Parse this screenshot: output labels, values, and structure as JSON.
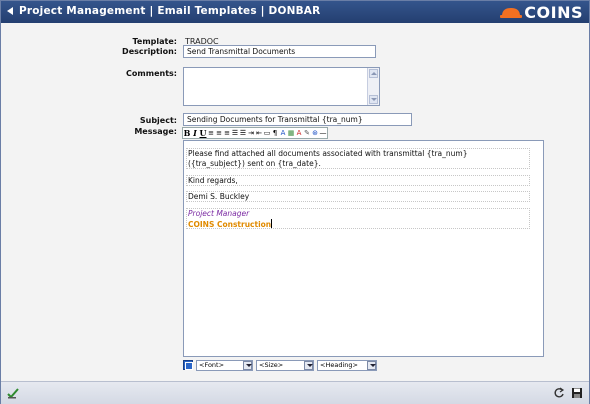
{
  "header": {
    "title": "Project Management | Email Templates | DONBAR",
    "logo_text": "COINS",
    "logo_color": "#f37021"
  },
  "form": {
    "template_label": "Template:",
    "template_value": "TRADOC",
    "description_label": "Description:",
    "description_value": "Send Transmittal Documents",
    "comments_label": "Comments:",
    "comments_value": "",
    "subject_label": "Subject:",
    "subject_value": "Sending Documents for Transmittal {tra_num}",
    "message_label": "Message:"
  },
  "editor": {
    "toolbar": [
      "B",
      "I",
      "U",
      "≡",
      "≡",
      "≡",
      "☰",
      "☰",
      "⇥",
      "⇤",
      "▭",
      "¶",
      "A",
      "▦",
      "A",
      "✎",
      "⊛",
      "—"
    ],
    "para1_line1": "Please find attached all documents associated with transmittal {tra_num}",
    "para1_line2": "({tra_subject}) sent on {tra_date}.",
    "para2": "Kind regards,",
    "para3": "Demi S. Buckley",
    "para4_line1": "Project Manager",
    "para4_line2": "COINS Construction",
    "font_select": "<Font>",
    "size_select": "<Size>",
    "heading_select": "<Heading>"
  },
  "icons": {
    "status_left": "check-edit-icon",
    "status_right1": "refresh-icon",
    "status_right2": "save-icon"
  }
}
